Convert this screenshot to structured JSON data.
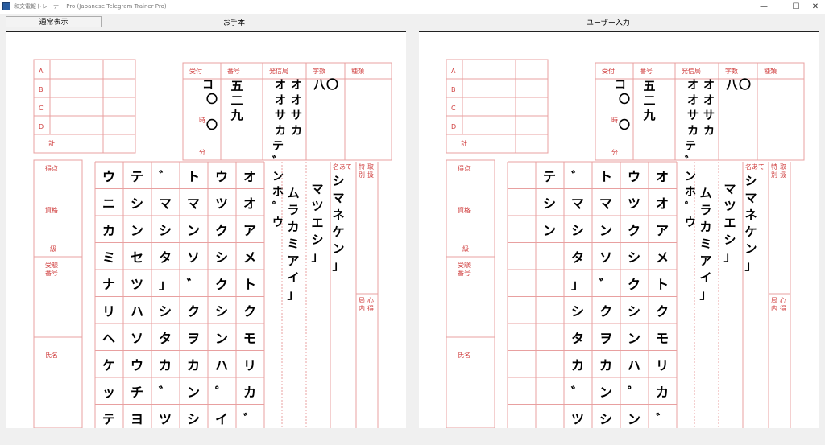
{
  "window": {
    "title": "和文電報トレーナー Pro (Japanese Telegram Trainer Pro)",
    "minimize": "—",
    "maximize": "☐",
    "close": "✕"
  },
  "toolbar": {
    "mode_button": "通常表示"
  },
  "panels": {
    "left": {
      "label": "お手本"
    },
    "right": {
      "label": "ユーザー入力"
    }
  },
  "form": {
    "side_rows": [
      "A",
      "B",
      "C",
      "D"
    ],
    "side_total": "計",
    "left_col_labels": {
      "score": "得点",
      "qualification": "資格",
      "grade": "級",
      "exam_number": "受験番号",
      "name": "氏名"
    },
    "header_labels": {
      "received": "受付",
      "number": "番号",
      "origin": "発信局",
      "char_count": "字数",
      "type": "種類"
    },
    "received_unit_hour": "時",
    "received_unit_minute": "分",
    "addressee_label": "名あて",
    "right_labels": {
      "special": "特別取扱",
      "internal": "局内心得"
    },
    "colors": {
      "grid": "#e8a0a0",
      "label": "#d04040",
      "ink": "#000000"
    }
  },
  "model": {
    "received_value": "コ〇〇",
    "number": "五二九",
    "origin": "オオサカテ゛ンホ゜ウ",
    "char_count": "八〇",
    "addressee": "シマネケン」",
    "address2": "マツエシ」",
    "address3": "ムラカミアイ」",
    "body_columns": [
      "オオアメトクモリカ゛",
      "ウツクシクシンハ゜イ",
      "トマンソ゛クヲカンシ",
      "゛マシタ」シタカ゛ツ",
      "テシンセツハソウチヨ",
      "ウニカミナリヘケッテ"
    ]
  },
  "user": {
    "received_value": "コ〇〇",
    "number": "五二九",
    "origin": "オオサカテ゛ンホ゜ウ",
    "char_count": "八〇",
    "addressee": "シマネケン」",
    "address2": "マツエシ」",
    "address3": "ムラカミアイ」",
    "body_columns": [
      "オオアメトクモリカ゛イ",
      "ウツクシクシンハ゜ンシ",
      "トマンソ゛クヲカンシ",
      "゛マシタ」シタカ゛ツ",
      "テシン",
      ""
    ]
  }
}
